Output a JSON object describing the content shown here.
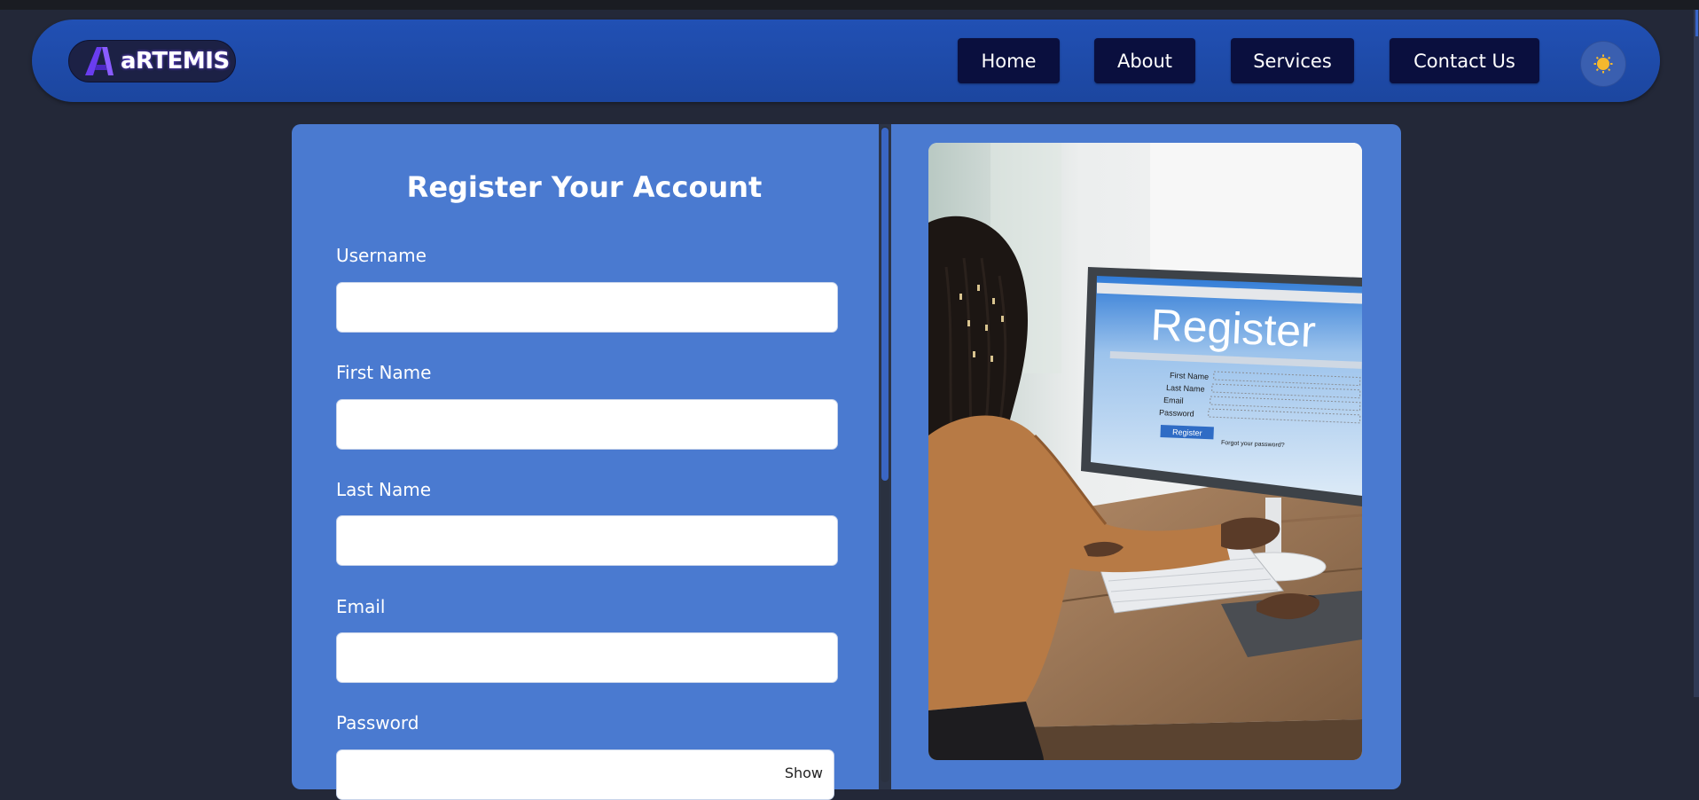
{
  "brand": {
    "name": "aRTEMIS",
    "logo_icon": "artemis-a-logo-icon"
  },
  "nav": {
    "items": [
      {
        "label": "Home"
      },
      {
        "label": "About"
      },
      {
        "label": "Services"
      },
      {
        "label": "Contact Us"
      }
    ],
    "theme_toggle_icon": "sun-icon"
  },
  "form": {
    "title": "Register Your Account",
    "fields": [
      {
        "label": "Username",
        "value": ""
      },
      {
        "label": "First Name",
        "value": ""
      },
      {
        "label": "Last Name",
        "value": ""
      },
      {
        "label": "Email",
        "value": ""
      },
      {
        "label": "Password",
        "value": "",
        "toggle": "Show"
      }
    ]
  },
  "illustration": {
    "screen_heading": "Register",
    "screen_fields": [
      "First Name",
      "Last Name",
      "Email",
      "Password"
    ],
    "screen_button": "Register",
    "screen_link": "Forgot your password?"
  },
  "colors": {
    "page_bg": "#232838",
    "navbar": "#2150b4",
    "nav_button": "#0a0f3e",
    "card": "#4a7ad0",
    "sun": "#f5b82e"
  }
}
